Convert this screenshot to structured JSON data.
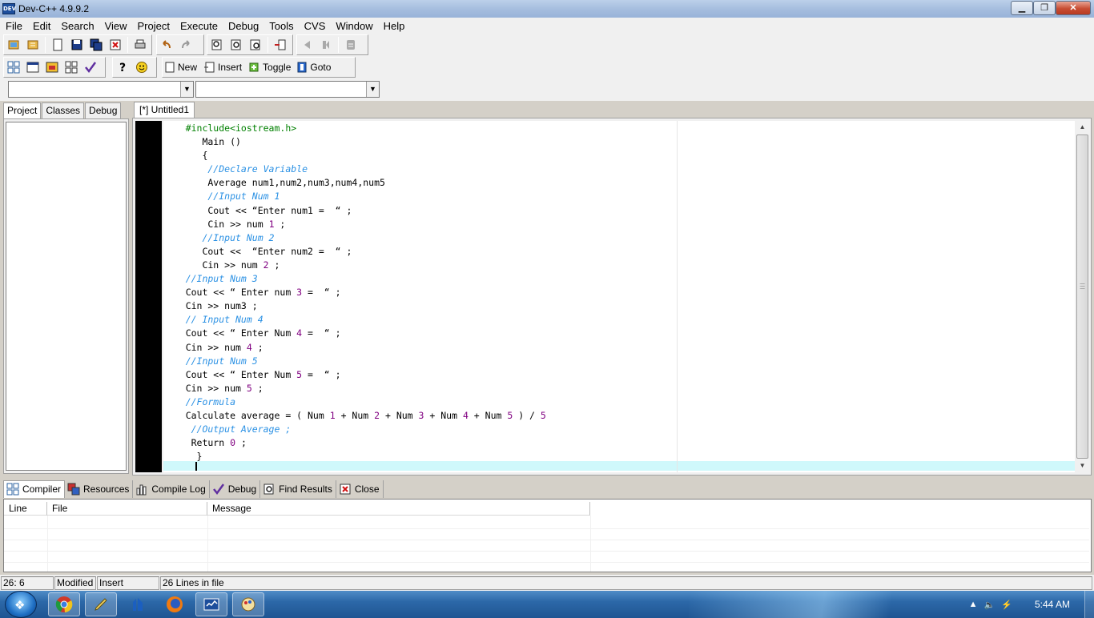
{
  "window": {
    "title": "Dev-C++ 4.9.9.2",
    "icon_label": "DEV"
  },
  "menu": [
    "File",
    "Edit",
    "Search",
    "View",
    "Project",
    "Execute",
    "Debug",
    "Tools",
    "CVS",
    "Window",
    "Help"
  ],
  "toolbar2": {
    "new_label": "New",
    "insert_label": "Insert",
    "toggle_label": "Toggle",
    "goto_label": "Goto"
  },
  "left_tabs": [
    "Project",
    "Classes",
    "Debug"
  ],
  "editor": {
    "tab_label": "[*] Untitled1",
    "lines": [
      [
        {
          "t": "    #include<iostream.h>",
          "c": "pp"
        }
      ],
      [
        {
          "t": "       Main ()",
          "c": ""
        }
      ],
      [
        {
          "t": "       {",
          "c": ""
        }
      ],
      [
        {
          "t": "        //Declare Variable",
          "c": "cm"
        }
      ],
      [
        {
          "t": "        Average num1,num2,num3,num4,num5",
          "c": ""
        }
      ],
      [
        {
          "t": "        //Input Num 1",
          "c": "cm"
        }
      ],
      [
        {
          "t": "        Cout << “Enter num1 =  “ ;",
          "c": ""
        }
      ],
      [
        {
          "t": "        Cin >> num ",
          "c": ""
        },
        {
          "t": "1",
          "c": "num"
        },
        {
          "t": " ;",
          "c": ""
        }
      ],
      [
        {
          "t": "       //Input Num 2",
          "c": "cm"
        }
      ],
      [
        {
          "t": "       Cout <<  “Enter num2 =  “ ;",
          "c": ""
        }
      ],
      [
        {
          "t": "       Cin >> num ",
          "c": ""
        },
        {
          "t": "2",
          "c": "num"
        },
        {
          "t": " ;",
          "c": ""
        }
      ],
      [
        {
          "t": "    //Input Num 3",
          "c": "cm"
        }
      ],
      [
        {
          "t": "    Cout << “ Enter num ",
          "c": ""
        },
        {
          "t": "3",
          "c": "num"
        },
        {
          "t": " =  “ ;",
          "c": ""
        }
      ],
      [
        {
          "t": "    Cin >> num3 ;",
          "c": ""
        }
      ],
      [
        {
          "t": "    // Input Num 4",
          "c": "cm"
        }
      ],
      [
        {
          "t": "    Cout << “ Enter Num ",
          "c": ""
        },
        {
          "t": "4",
          "c": "num"
        },
        {
          "t": " =  “ ;",
          "c": ""
        }
      ],
      [
        {
          "t": "    Cin >> num ",
          "c": ""
        },
        {
          "t": "4",
          "c": "num"
        },
        {
          "t": " ;",
          "c": ""
        }
      ],
      [
        {
          "t": "    //Input Num 5",
          "c": "cm"
        }
      ],
      [
        {
          "t": "    Cout << “ Enter Num ",
          "c": ""
        },
        {
          "t": "5",
          "c": "num"
        },
        {
          "t": " =  “ ;",
          "c": ""
        }
      ],
      [
        {
          "t": "    Cin >> num ",
          "c": ""
        },
        {
          "t": "5",
          "c": "num"
        },
        {
          "t": " ;",
          "c": ""
        }
      ],
      [
        {
          "t": "    //Formula",
          "c": "cm"
        }
      ],
      [
        {
          "t": "    Calculate average = ( Num ",
          "c": ""
        },
        {
          "t": "1",
          "c": "num"
        },
        {
          "t": " + Num ",
          "c": ""
        },
        {
          "t": "2",
          "c": "num"
        },
        {
          "t": " + Num ",
          "c": ""
        },
        {
          "t": "3",
          "c": "num"
        },
        {
          "t": " + Num ",
          "c": ""
        },
        {
          "t": "4",
          "c": "num"
        },
        {
          "t": " + Num ",
          "c": ""
        },
        {
          "t": "5",
          "c": "num"
        },
        {
          "t": " ) / ",
          "c": ""
        },
        {
          "t": "5",
          "c": "num"
        }
      ],
      [
        {
          "t": "     //Output Average ;",
          "c": "cm"
        }
      ],
      [
        {
          "t": "     Return ",
          "c": ""
        },
        {
          "t": "0",
          "c": "num"
        },
        {
          "t": " ;",
          "c": ""
        }
      ],
      [
        {
          "t": "      }",
          "c": ""
        }
      ]
    ]
  },
  "bottom_tabs": [
    "Compiler",
    "Resources",
    "Compile Log",
    "Debug",
    "Find Results",
    "Close"
  ],
  "results_columns": [
    "Line",
    "File",
    "Message"
  ],
  "status": {
    "position": "26: 6",
    "modified": "Modified",
    "mode": "Insert",
    "lines_info": "26 Lines in file"
  },
  "taskbar": {
    "clock": "5:44 AM"
  },
  "colors": {
    "preprocessor": "#008000",
    "comment": "#2b91e4",
    "number": "#800080",
    "current_line": "#cff8fb"
  }
}
